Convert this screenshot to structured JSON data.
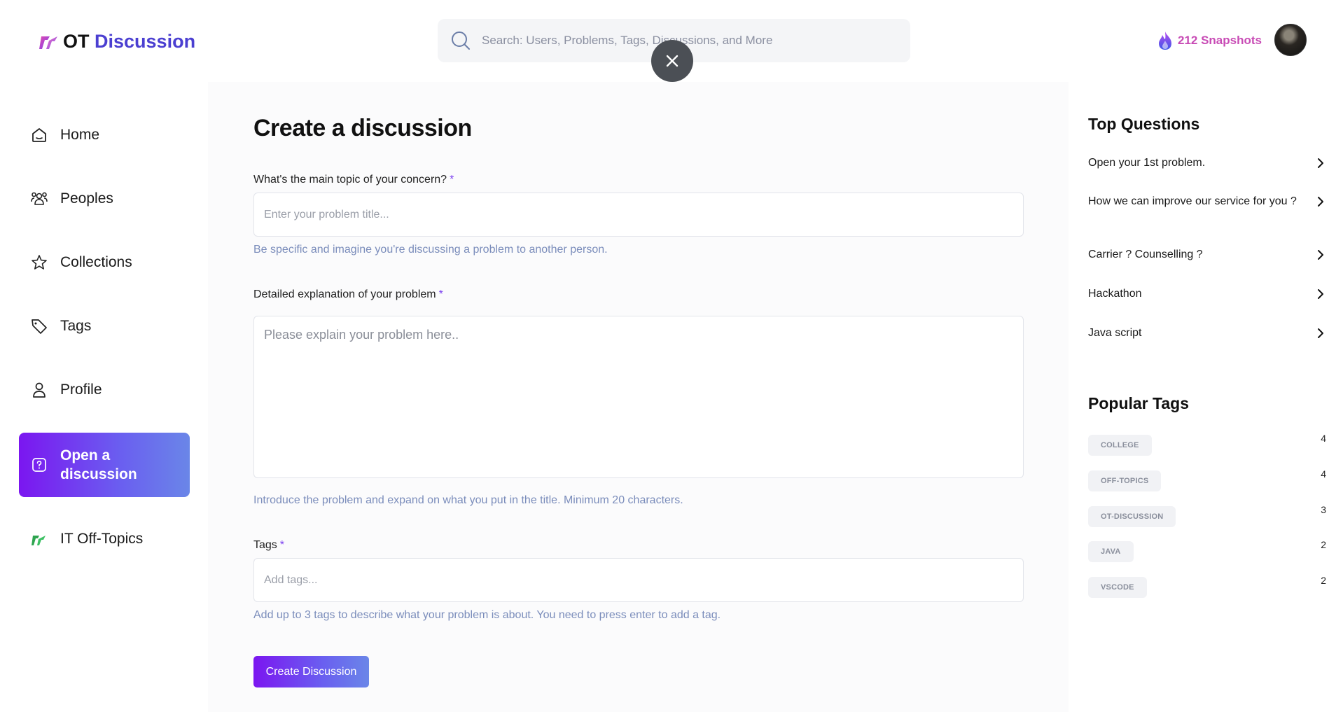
{
  "header": {
    "logo_ot": "OT",
    "logo_discussion": "Discussion",
    "search_placeholder": "Search: Users, Problems, Tags, Discussions, and More",
    "snapshots": "212 Snapshots"
  },
  "sidebar": {
    "items": [
      {
        "label": "Home",
        "icon": "home-icon"
      },
      {
        "label": "Peoples",
        "icon": "people-icon"
      },
      {
        "label": "Collections",
        "icon": "star-icon"
      },
      {
        "label": "Tags",
        "icon": "tag-icon"
      },
      {
        "label": "Profile",
        "icon": "user-icon"
      },
      {
        "label_line1": "Open a",
        "label_line2": "discussion",
        "icon": "question-icon",
        "active": true
      },
      {
        "label": "IT Off-Topics",
        "icon": "logo-icon"
      }
    ]
  },
  "form": {
    "title": "Create a discussion",
    "topic_label": "What's the main topic of your concern?",
    "required_mark": "*",
    "topic_placeholder": "Enter your problem title...",
    "topic_hint": "Be specific and imagine you're discussing a problem to another person.",
    "explanation_label": "Detailed explanation of your problem",
    "explanation_placeholder": "Please explain your problem here..",
    "explanation_hint": "Introduce the problem and expand on what you put in the title. Minimum 20 characters.",
    "tags_label": "Tags",
    "tags_placeholder": "Add tags...",
    "tags_hint": "Add up to 3 tags to describe what your problem is about. You need to press enter to add a tag.",
    "submit_label": "Create Discussion"
  },
  "rightbar": {
    "top_questions_title": "Top Questions",
    "questions": [
      "Open your 1st problem.",
      "How we can improve our service for you ?",
      "Carrier ? Counselling ?",
      "Hackathon",
      "Java script"
    ],
    "popular_tags_title": "Popular Tags",
    "tags": [
      {
        "name": "COLLEGE",
        "count": "4"
      },
      {
        "name": "OFF-TOPICS",
        "count": "4"
      },
      {
        "name": "OT-DISCUSSION",
        "count": "3"
      },
      {
        "name": "JAVA",
        "count": "2"
      },
      {
        "name": "VSCODE",
        "count": "2"
      }
    ]
  },
  "colors": {
    "brand": "#4b3fd1",
    "accent_gradient_start": "#7b16f0",
    "accent_gradient_end": "#6a86e8",
    "snapshots": "#c84bb5",
    "hint": "#7b8dbb"
  }
}
